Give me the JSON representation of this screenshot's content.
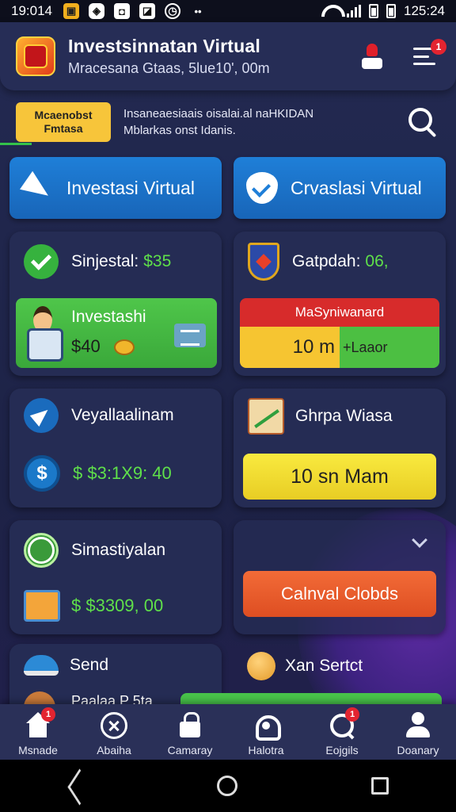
{
  "status_bar": {
    "time_left": "19:014",
    "time_right": "125:24",
    "icons": [
      "notification-icon",
      "app-icon",
      "camera-icon",
      "news-icon",
      "alarm-icon",
      "more-icon",
      "wifi-icon",
      "signal-icon",
      "battery-icon"
    ]
  },
  "header": {
    "title": "Investsinnatan Virtual",
    "subtitle": "Mracesana Gtaas, 5lue10', 00m",
    "notification_badge": "1"
  },
  "ticker": {
    "tag_line1": "Mcaenobst",
    "tag_line2": "Fmtasa",
    "text_line1": "Insaneaesiaais oisalai.al naHKIDAN",
    "text_line2": "Mblarkas onst Idanis."
  },
  "top_buttons": {
    "left_label": "Investasi Virtual",
    "right_label": "Crvaslasi Virtual"
  },
  "cards": {
    "card1": {
      "label": "Sinjestal:",
      "value": "$35",
      "invest_label": "Investashi",
      "invest_amount": "$40"
    },
    "card2": {
      "label": "Gatpdah:",
      "value": "06,",
      "progress_title": "MaSyniwanard",
      "progress_value": "10 m",
      "progress_suffix": "+Laaor",
      "progress_fraction": 0.5
    },
    "card3": {
      "label": "Veyallaalinam",
      "amount": "$ $3:1X9: 40"
    },
    "card4": {
      "label": "Ghrpa Wiasa",
      "button": "10 sn Mam"
    },
    "card5": {
      "label": "Simastiyalan",
      "amount": "$ $3309, 00"
    },
    "card6": {
      "button": "Calnval Clobds"
    },
    "row_bottom": {
      "left_label": "Send",
      "right_label": "Xan Sertct",
      "partial_label": "Paalaa P 5ta"
    }
  },
  "bottom_nav": [
    {
      "label": "Msnade",
      "icon": "home-icon",
      "badge": "1"
    },
    {
      "label": "Abaiha",
      "icon": "close-circle-icon",
      "badge": ""
    },
    {
      "label": "Camaray",
      "icon": "lock-icon",
      "badge": ""
    },
    {
      "label": "Halotra",
      "icon": "camera-icon",
      "badge": ""
    },
    {
      "label": "Eojgils",
      "icon": "search-icon",
      "badge": "1"
    },
    {
      "label": "Doanary",
      "icon": "person-icon",
      "badge": ""
    }
  ],
  "colors": {
    "accent_blue": "#1f7fd8",
    "accent_green": "#4fc64a",
    "accent_yellow": "#f9ea3f",
    "accent_orange": "#f26b37",
    "background": "#1f2547"
  }
}
